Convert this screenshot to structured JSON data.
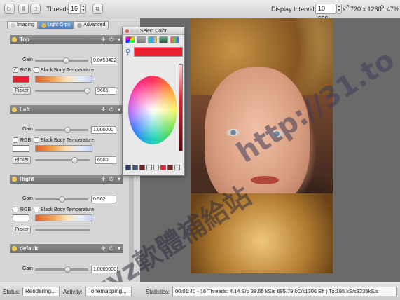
{
  "toolbar": {
    "threads_label": "Threads:",
    "threads_value": "16",
    "display_interval_label": "Display Interval:",
    "display_interval_value": "10 sec",
    "resolution": "720 x 1280",
    "zoom": "47%"
  },
  "panel": {
    "tabs": [
      "Imaging",
      "Light Grps",
      "Advanced"
    ],
    "groups": [
      {
        "name": "Top",
        "gain_label": "Gain",
        "gain_value": "0.8#58422",
        "rgb_label": "RGB",
        "rgb_checked": true,
        "bbt_label": "Black Body Temperature",
        "picker_label": "Picker",
        "temp_value": "9666",
        "swatch_color": "#e8202f"
      },
      {
        "name": "Left",
        "gain_label": "Gain",
        "gain_value": "1.000000",
        "rgb_label": "RGB",
        "rgb_checked": false,
        "bbt_label": "Black Body Temperature",
        "picker_label": "Picker",
        "temp_value": "6500",
        "swatch_color": "#ffffff"
      },
      {
        "name": "Right",
        "gain_label": "Gain",
        "gain_value": "0.562",
        "rgb_label": "RGB",
        "rgb_checked": false,
        "bbt_label": "Black Body Temperature",
        "picker_label": "Picker",
        "temp_value": "",
        "swatch_color": "#ffffff"
      },
      {
        "name": "default",
        "gain_label": "Gain",
        "gain_value": "1.0000000"
      }
    ]
  },
  "color_dialog": {
    "title": "Select Color",
    "selected_color": "#e8202f"
  },
  "watermark": {
    "line1": "xyz軟體補給站",
    "line2": "http://31.to"
  },
  "status": {
    "status_label": "Status:",
    "status_value": "Rendering...",
    "activity_label": "Activity:",
    "activity_value": "Tonemapping...",
    "statistics_label": "Statistics:",
    "statistics_value": "00:01:40 - 16 Threads: 4.14 S/p  38.65 kS/s  695.79 kC/s1306 Eff | Tx:195 kS/s3235kS/s"
  }
}
